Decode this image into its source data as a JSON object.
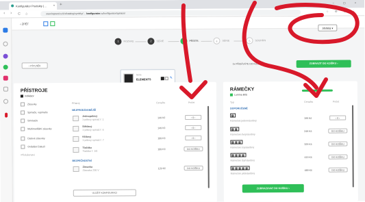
{
  "browser": {
    "tab_title": "Konfigurátor Produkty | ...",
    "tab_close": "×",
    "new_tab": "+",
    "window_controls": "– ▢ ×",
    "nav_back": "‹",
    "nav_forward": "›",
    "nav_reload": "C",
    "nav_home": "⌂",
    "url_prefix": "www.legrand.cz/Cs/katalog/vyrobky/ ... ",
    "url_bold": "konfigurator",
    "url_suffix": ".cz/konfigurator/spinace/",
    "extensions": "☆ ◍ ◍ ⋮"
  },
  "topbar": {
    "back_label": "‹ ZPĚT",
    "entity_select": "Jiří/Bílá ▾"
  },
  "steps": [
    {
      "num": "1",
      "label": "ROZVAD."
    },
    {
      "num": "2",
      "label": "SÉRIE"
    },
    {
      "num": "3",
      "label": "PŘÍSTR."
    },
    {
      "num": "4",
      "label": "SÉRIE"
    },
    {
      "num": "5",
      "label": "SOUHRN"
    }
  ],
  "selection": {
    "series_label": "Série",
    "series_name": "ELEMENTS"
  },
  "actions": {
    "back_button": "‹ VÝPLNĚK",
    "frames_info": "3x PŘIDÁVÁTE DO KOŠÍKU",
    "add_to_cart_top": "ZOBRAZIT DO KOŠÍKU ›",
    "add_to_cart_bottom": "ZOBRAZOVAT DO KOŠÍKU ›",
    "save_config": "ULOŽIT KONFIGURACI"
  },
  "devices": {
    "title": "PŘÍSTROJE",
    "subtitle": "Indikátor",
    "filters": [
      "Zásuvky",
      "Spínače, vypínače",
      "Stmívače",
      "Multimediální zásuvky",
      "Datové zásuvky",
      "Ovládání žaluzií",
      "Příslušenství"
    ],
    "col_product": "Přístroj",
    "col_price": "Cena/ks",
    "col_qty": "Počet",
    "group_1": "NEJPRODÁVANĚJŠÍ",
    "group_2": "BEZPEČNOSTNÍ",
    "items": [
      {
        "name": "Jednopólový",
        "desc": "1-pólový spínač ř. 1",
        "price": "149 Kč",
        "qty": "‹ 0 ›"
      },
      {
        "name": "Střídavý",
        "desc": "1-pólový spínač ř. 6",
        "price": "149 Kč",
        "qty": "‹ 0 ›"
      },
      {
        "name": "Křížový",
        "desc": "1-pólový spínač ř. 7",
        "price": "189 Kč",
        "qty": "‹ 0 ›"
      },
      {
        "name": "Tlačítko",
        "desc": "Tlačítko ř. 1/0",
        "price": "189 Kč",
        "qty": "DO KOŠÍKU"
      },
      {
        "name": "Zásuvka",
        "desc": "Zásuvka 230 V",
        "price": "129 Kč",
        "qty": "DO KOŠÍKU"
      }
    ]
  },
  "frames": {
    "title": "RÁMEČKY",
    "subtitle": "Lumina Bílá",
    "col_type": "Typ",
    "col_price": "Cena/ks",
    "col_qty": "Počet",
    "group": "DOPORUČENÉ",
    "items": [
      {
        "name": "Rámeček jednonásobný",
        "price": "199 Kč",
        "qty": "‹ 0 ›"
      },
      {
        "name": "Rámeček dvojnásobný",
        "price": "249 Kč",
        "qty": "DO KOŠÍKU"
      },
      {
        "name": "Rámeček trojnásobný",
        "price": "329 Kč",
        "qty": "DO KOŠÍKU"
      },
      {
        "name": "Rámeček čtyřnásobný",
        "price": "419 Kč",
        "qty": "DO KOŠÍKU"
      },
      {
        "name": "Rámeček pětinásobný",
        "price": "489 Kč",
        "qty": "DO KOŠÍKU"
      }
    ]
  },
  "colors": {
    "accent_green": "#2fbf58",
    "annotation_red": "#d8192a",
    "link_blue": "#2c7be5"
  }
}
